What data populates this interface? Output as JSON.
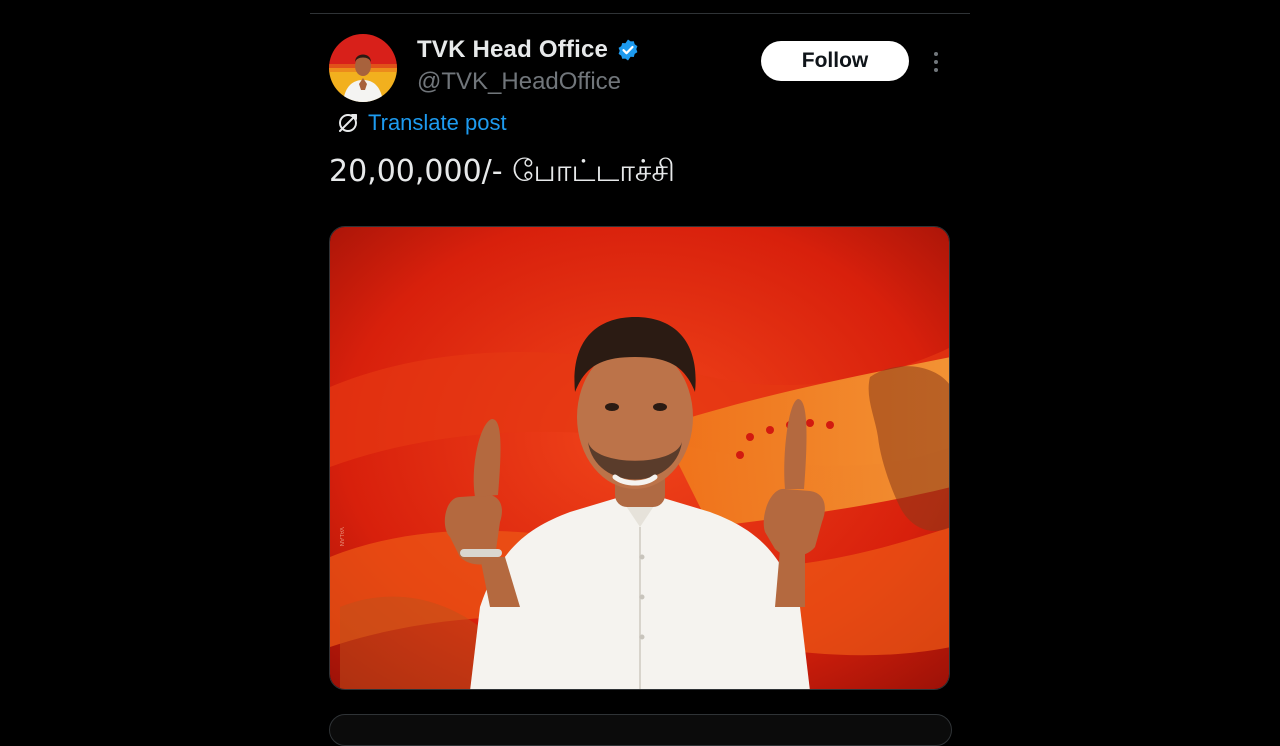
{
  "post": {
    "author": {
      "display_name": "TVK Head Office",
      "handle": "@TVK_HeadOffice",
      "verified": true,
      "avatar_icon": "profile-avatar"
    },
    "follow_label": "Follow",
    "more_icon": "more-vertical-icon",
    "translate_label": "Translate post",
    "translate_icon": "translate-icon",
    "text": "20,00,000/- போட்டாச்சி",
    "media": {
      "kind": "photo",
      "watermark": "VALAN"
    }
  },
  "colors": {
    "background": "#000000",
    "text_primary": "#e7e9ea",
    "text_secondary": "#71767b",
    "link": "#1d9bf0",
    "verified": "#1d9bf0",
    "follow_bg": "#ffffff",
    "poster_red": "#e5220e",
    "poster_yellow": "#f2a20f"
  }
}
